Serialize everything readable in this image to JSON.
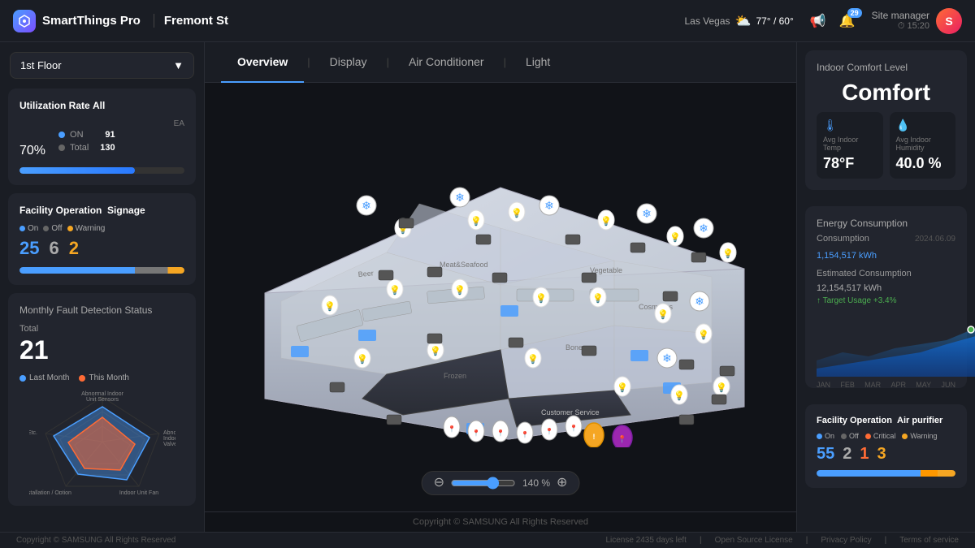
{
  "header": {
    "logo_icon": "⬡",
    "app_name": "SmartThings Pro",
    "location": "Fremont St",
    "weather": {
      "city": "Las Vegas",
      "icon": "⛅",
      "temp": "77°",
      "low": "60°"
    },
    "notification_count": "29",
    "site_manager_label": "Site manager",
    "time": "15:20",
    "avatar_initials": "S"
  },
  "floor_selector": {
    "label": "1st Floor",
    "icon": "▼"
  },
  "utilization": {
    "title": "Utilization Rate",
    "subtitle": "All",
    "ea_label": "EA",
    "percent": "70",
    "percent_sym": "%",
    "on_label": "● ON",
    "on_value": "91",
    "total_label": "● Total",
    "total_value": "130",
    "progress": 70
  },
  "facility_operation": {
    "title": "Facility Operation",
    "subtitle": "Signage",
    "on_label": "On",
    "on_value": "25",
    "off_label": "Off",
    "off_value": "6",
    "warning_label": "Warning",
    "warning_value": "2"
  },
  "monthly_fault": {
    "title": "Monthly Fault Detection Status",
    "total_label": "Total",
    "total_value": "21",
    "last_month_label": "Last Month",
    "this_month_label": "This Month",
    "radar_labels": [
      "Abnormal Indoor Unit Sensors",
      "Abnormal Indoor Unit Valve",
      "Indoor Unit Fan / Motor Error",
      "Installation / Option Setting Error",
      "Etc."
    ]
  },
  "tabs": [
    {
      "id": "overview",
      "label": "Overview",
      "active": true
    },
    {
      "id": "display",
      "label": "Display",
      "active": false
    },
    {
      "id": "air-conditioner",
      "label": "Air Conditioner",
      "active": false
    },
    {
      "id": "light",
      "label": "Light",
      "active": false
    }
  ],
  "map": {
    "zoom_percent": "140 %",
    "zoom_minus": "⊖",
    "zoom_plus": "⊕"
  },
  "footer": {
    "copyright": "Copyright © SAMSUNG All Rights Reserved",
    "license": "License 2435 days left",
    "open_source": "Open Source License",
    "privacy": "Privacy Policy",
    "terms": "Terms of service"
  },
  "indoor_comfort": {
    "title": "Indoor Comfort Level",
    "level": "Comfort",
    "temp_label": "Avg Indoor Temp",
    "temp_value": "78",
    "temp_unit": "°F",
    "humidity_label": "Avg Indoor Humidity",
    "humidity_value": "40.0",
    "humidity_unit": " %"
  },
  "energy": {
    "title": "Energy Consumption",
    "consumption_label": "Consumption",
    "date": "2024.06.09",
    "consumption_value": "1,154,517",
    "consumption_unit": " kWh",
    "estimated_label": "Estimated Consumption",
    "estimated_value": "12,154,517",
    "estimated_unit": " kWh",
    "target_label": "↑ Target Usage +3.4%",
    "chart_months": [
      "JAN",
      "FEB",
      "MAR",
      "APR",
      "MAY",
      "JUN"
    ]
  },
  "right_facility": {
    "title": "Facility Operation",
    "subtitle": "Air purifier",
    "on_label": "On",
    "on_value": "55",
    "off_label": "Off",
    "off_value": "2",
    "critical_label": "Critical",
    "critical_value": "1",
    "warning_label": "Warning",
    "warning_value": "3"
  }
}
